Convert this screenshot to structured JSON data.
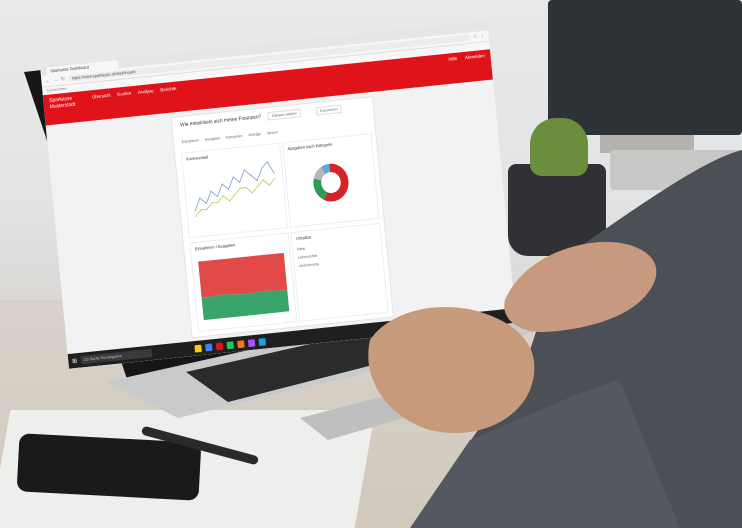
{
  "scene": {
    "wall_color": "#e9eaeb",
    "desk_color": "#d9d6d2"
  },
  "browser": {
    "tab_title": "Sparkasse Dashboard",
    "url": "https://www.sparkasse.de/dashboard",
    "bookmarks": "Lesezeichen",
    "icons": [
      "back-icon",
      "forward-icon",
      "reload-icon",
      "star-icon",
      "menu-icon"
    ]
  },
  "app": {
    "accent": "#e0131b",
    "logo_line1": "Sparkasse",
    "logo_line2": "Musterstadt",
    "nav": [
      "Übersicht",
      "Konten",
      "Analyse",
      "Berichte"
    ],
    "top_right": [
      "Hilfe",
      "Abmelden"
    ],
    "panel_title": "Wie entwickeln sich meine Finanzen?",
    "panel_buttons": [
      "Zeitraum wählen",
      "Exportieren"
    ],
    "filter_tags": [
      "Einnahmen",
      "Ausgaben",
      "Kategorien",
      "Verträge",
      "Sparen"
    ],
    "line_card_title": "Kontoverlauf",
    "donut_card_title": "Ausgaben nach Kategorie",
    "bar_card_title": "Einnahmen / Ausgaben",
    "list_card_title": "Umsätze",
    "list_rows": [
      "Miete",
      "Lebensmittel",
      "Versicherung"
    ]
  },
  "taskbar": {
    "search_placeholder": "Zur Suche Text eingeben",
    "icon_colors": [
      "#ffcc00",
      "#3b82f6",
      "#e0131b",
      "#22c55e",
      "#f97316",
      "#a855f7",
      "#0ea5e9"
    ]
  },
  "chart_data": [
    {
      "type": "line",
      "title": "",
      "series": [
        {
          "values": [
            3,
            5,
            4,
            6,
            5,
            7,
            6,
            8,
            7,
            9,
            8,
            7,
            9,
            10,
            8
          ]
        },
        {
          "values": [
            2,
            3,
            3,
            4,
            4,
            5,
            4,
            5,
            6,
            6,
            5,
            6,
            7,
            6,
            7
          ]
        }
      ]
    },
    {
      "type": "pie",
      "title": "",
      "values": [
        58,
        22,
        12,
        8
      ],
      "colors": [
        "#d6232b",
        "#2f9a55",
        "#b7b7b7",
        "#5aa9d6"
      ]
    },
    {
      "type": "area",
      "title": "",
      "series": [
        {
          "values": [
            62,
            60,
            63,
            61,
            64
          ]
        },
        {
          "values": [
            38,
            40,
            37,
            39,
            36
          ]
        }
      ],
      "colors": [
        "#e24a4a",
        "#3aa56a"
      ]
    }
  ]
}
